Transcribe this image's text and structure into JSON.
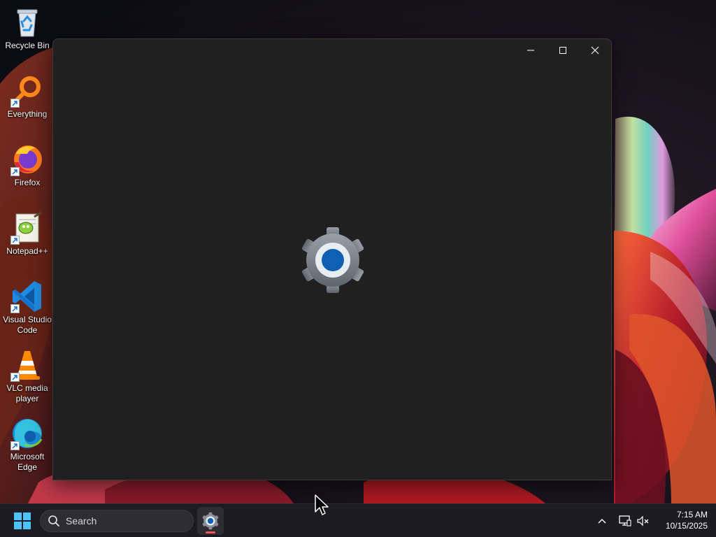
{
  "desktop": {
    "icons": [
      {
        "label": "Recycle Bin",
        "icon": "recycle-bin-icon",
        "shortcut": false
      },
      {
        "label": "Everything",
        "icon": "everything-search-icon",
        "shortcut": true
      },
      {
        "label": "Firefox",
        "icon": "firefox-icon",
        "shortcut": true
      },
      {
        "label": "Notepad++",
        "icon": "notepad-plus-plus-icon",
        "shortcut": true
      },
      {
        "label": "Visual Studio Code",
        "icon": "vscode-icon",
        "shortcut": true
      },
      {
        "label": "VLC media player",
        "icon": "vlc-icon",
        "shortcut": true
      },
      {
        "label": "Microsoft Edge",
        "icon": "edge-icon",
        "shortcut": true
      }
    ]
  },
  "window": {
    "app": "Settings",
    "state": "loading splash",
    "controls": {
      "minimize": "minimize-icon",
      "maximize": "maximize-icon",
      "close": "close-icon"
    },
    "splash_icon": "settings-gear-icon"
  },
  "taskbar": {
    "search_placeholder": "Search",
    "pinned_running_app": "settings-gear-icon",
    "tray_icons": [
      "chevron-up-icon",
      "network-icon",
      "volume-muted-icon"
    ],
    "time": "7:15 AM",
    "date": "10/15/2025"
  },
  "colors": {
    "window_bg": "#202020",
    "taskbar_bg": "#1c1b22",
    "accent_blue": "#0f5fb5",
    "active_indicator": "#f05a4f"
  }
}
